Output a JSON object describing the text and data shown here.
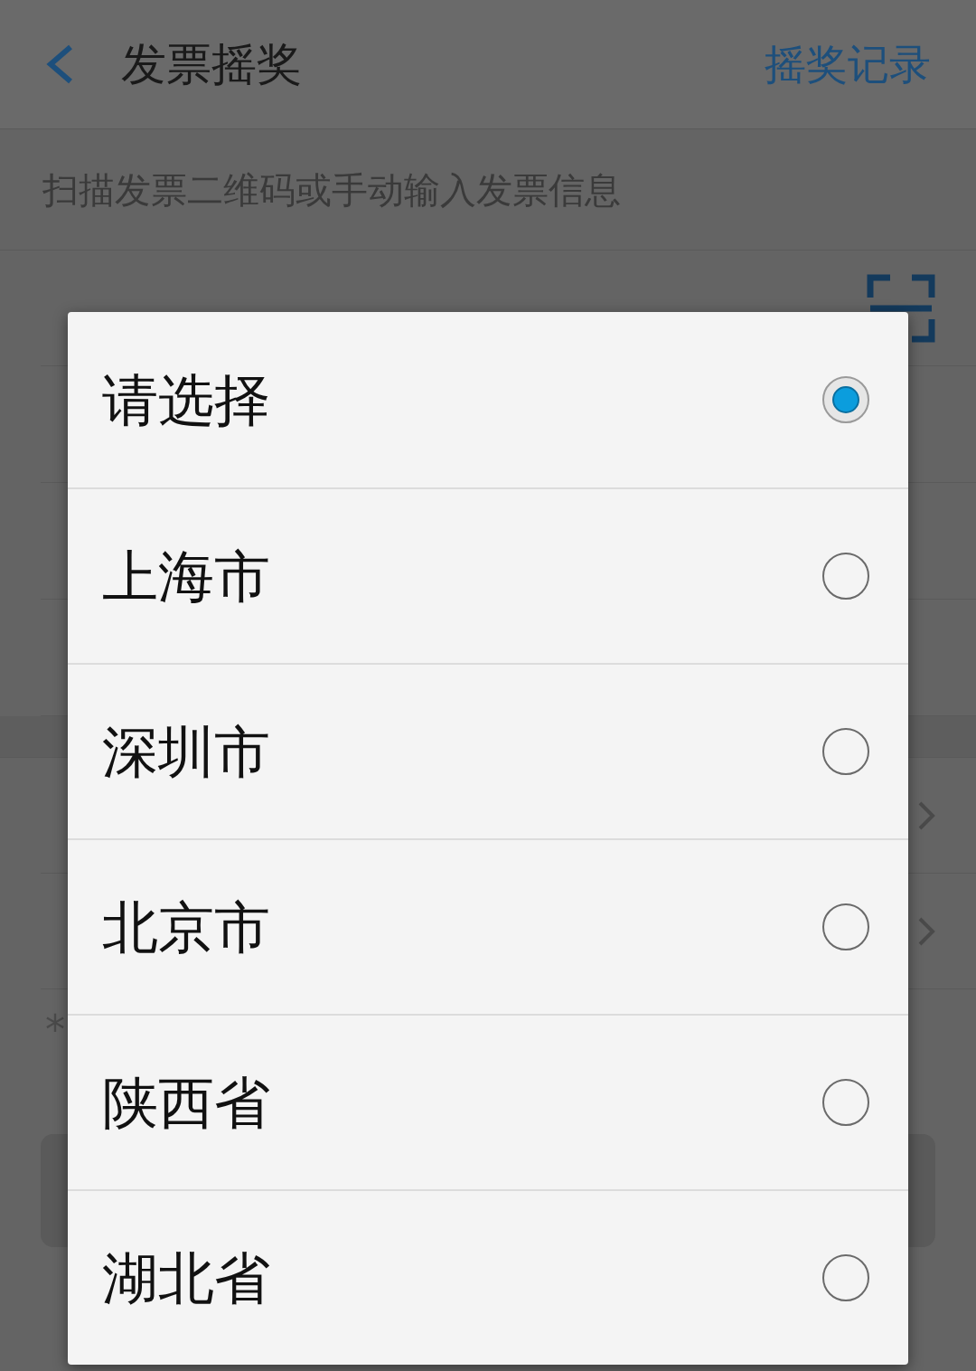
{
  "header": {
    "title": "发票摇奖",
    "action": "摇奖记录"
  },
  "hint": "扫描发票二维码或手动输入发票信息",
  "note": "*",
  "dialog": {
    "options": [
      {
        "label": "请选择",
        "selected": true
      },
      {
        "label": "上海市",
        "selected": false
      },
      {
        "label": "深圳市",
        "selected": false
      },
      {
        "label": "北京市",
        "selected": false
      },
      {
        "label": "陕西省",
        "selected": false
      },
      {
        "label": "湖北省",
        "selected": false
      }
    ]
  }
}
